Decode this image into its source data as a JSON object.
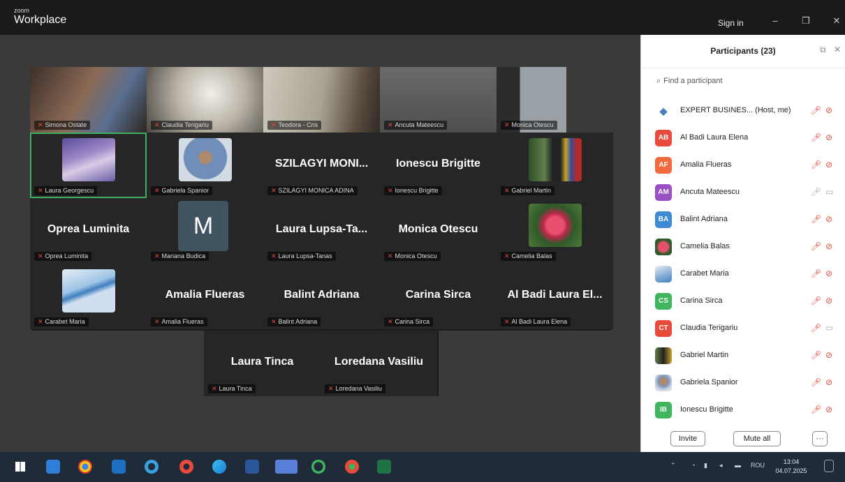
{
  "window": {
    "brand_small": "zoom",
    "brand_big": "Workplace",
    "sign_in": "Sign in",
    "min_glyph": "–",
    "max_glyph": "❐",
    "close_glyph": "✕"
  },
  "tiles": [
    {
      "caption": "Simona Ostate",
      "big": ""
    },
    {
      "caption": "Claudia Terigariu",
      "big": ""
    },
    {
      "caption": "Teodora - Cris",
      "big": ""
    },
    {
      "caption": "Ancuta Mateescu",
      "big": ""
    },
    {
      "caption": "Monica Otescu",
      "big": ""
    },
    {
      "caption": "Laura Georgescu",
      "big": ""
    },
    {
      "caption": "Gabriela Spanior",
      "big": ""
    },
    {
      "caption": "SZILAGYI MONICA ADINA",
      "big": "SZILAGYI  MONI..."
    },
    {
      "caption": "Ionescu Brigitte",
      "big": "Ionescu Brigitte"
    },
    {
      "caption": "Gabriel Martin",
      "big": ""
    },
    {
      "caption": "Oprea Luminita",
      "big": "Oprea Luminita"
    },
    {
      "caption": "Mariana Budica",
      "big": ""
    },
    {
      "caption": "Laura Lupsa-Tanas",
      "big": "Laura  Lupsa-Ta..."
    },
    {
      "caption": "Monica Otescu",
      "big": "Monica Otescu"
    },
    {
      "caption": "Camelia Balas",
      "big": ""
    },
    {
      "caption": "Carabet Maria",
      "big": ""
    },
    {
      "caption": "Amalia Flueras",
      "big": "Amalia Flueras"
    },
    {
      "caption": "Balint Adriana",
      "big": "Balint Adriana"
    },
    {
      "caption": "Carina Sirca",
      "big": "Carina Sirca"
    },
    {
      "caption": "Al Badi Laura Elena",
      "big": "Al Badi Laura El..."
    },
    {
      "caption": "Laura Tinca",
      "big": "Laura Tinca"
    },
    {
      "caption": "Loredana Vasiliu",
      "big": "Loredana Vasiliu"
    }
  ],
  "avatar_letter": "M",
  "panel": {
    "title": "Participants (23)",
    "search_placeholder": "Find a participant",
    "invite": "Invite",
    "mute_all": "Mute all",
    "more": "···",
    "participants": [
      {
        "initials": "",
        "name": "EXPERT BUSINES... (Host, me)",
        "color": "#4a7fc1",
        "camera": "off"
      },
      {
        "initials": "AB",
        "name": "Al Badi Laura Elena",
        "color": "#e84a3b",
        "camera": "off"
      },
      {
        "initials": "AF",
        "name": "Amalia Flueras",
        "color": "#f06a3c",
        "camera": "off"
      },
      {
        "initials": "AM",
        "name": "Ancuta Mateescu",
        "color": "#9b4fc4",
        "camera": "on"
      },
      {
        "initials": "BA",
        "name": "Balint Adriana",
        "color": "#3d8bd4",
        "camera": "off"
      },
      {
        "initials": "",
        "name": "Camelia Balas",
        "color": "#c23a4a",
        "camera": "off"
      },
      {
        "initials": "",
        "name": "Carabet Maria",
        "color": "#8fb4d8",
        "camera": "off"
      },
      {
        "initials": "CS",
        "name": "Carina Sirca",
        "color": "#3fb55e",
        "camera": "off"
      },
      {
        "initials": "CT",
        "name": "Claudia Terigariu",
        "color": "#e84a3b",
        "camera": "on"
      },
      {
        "initials": "",
        "name": "Gabriel Martin",
        "color": "#6b5a48",
        "camera": "off"
      },
      {
        "initials": "",
        "name": "Gabriela Spanior",
        "color": "#5f6f7f",
        "camera": "off"
      },
      {
        "initials": "IB",
        "name": "Ionescu Brigitte",
        "color": "#3fb55e",
        "camera": "off"
      }
    ]
  },
  "taskbar": {
    "lang": "ROU",
    "time": "13:04",
    "date": "04.07.2025"
  }
}
